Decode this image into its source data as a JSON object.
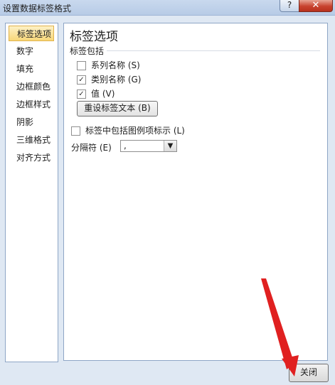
{
  "window": {
    "title": "设置数据标签格式",
    "help": "?",
    "close": "✕"
  },
  "sidebar": {
    "items": [
      "标签选项",
      "数字",
      "填充",
      "边框颜色",
      "边框样式",
      "阴影",
      "三维格式",
      "对齐方式"
    ],
    "selected": "标签选项"
  },
  "panel": {
    "title": "标签选项",
    "section": "标签包括",
    "checkboxes": [
      {
        "label": "系列名称 (S)",
        "checked": false
      },
      {
        "label": "类别名称 (G)",
        "checked": true
      },
      {
        "label": "值 (V)",
        "checked": true
      }
    ],
    "reset_button": "重设标签文本 (B)",
    "legend_key": {
      "label": "标签中包括图例项标示 (L)",
      "checked": false
    },
    "separator": {
      "label": "分隔符 (E)",
      "value": ","
    }
  },
  "footer": {
    "close_button": "关闭"
  },
  "colors": {
    "selected_nav": "#f8d779",
    "annotation_arrow": "#e02020"
  }
}
